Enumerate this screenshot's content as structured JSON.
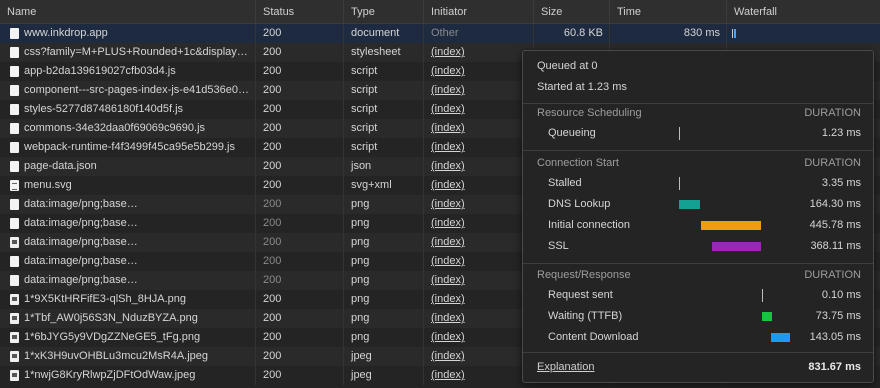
{
  "columns": [
    "Name",
    "Status",
    "Type",
    "Initiator",
    "Size",
    "Time",
    "Waterfall"
  ],
  "requests": [
    {
      "name": "www.inkdrop.app",
      "status": "200",
      "type": "document",
      "initiator": "Other",
      "size": "60.8 KB",
      "time": "830 ms",
      "icon": "document-icon"
    },
    {
      "name": "css?family=M+PLUS+Rounded+1c&display…",
      "status": "200",
      "type": "stylesheet",
      "initiator": "(index)",
      "icon": "document-icon"
    },
    {
      "name": "app-b2da139619027cfb03d4.js",
      "status": "200",
      "type": "script",
      "initiator": "(index)",
      "icon": "document-icon"
    },
    {
      "name": "component---src-pages-index-js-e41d536e0…",
      "status": "200",
      "type": "script",
      "initiator": "(index)",
      "icon": "document-icon"
    },
    {
      "name": "styles-5277d87486180f140d5f.js",
      "status": "200",
      "type": "script",
      "initiator": "(index)",
      "icon": "document-icon"
    },
    {
      "name": "commons-34e32daa0f69069c9690.js",
      "status": "200",
      "type": "script",
      "initiator": "(index)",
      "icon": "document-icon"
    },
    {
      "name": "webpack-runtime-f4f3499f45ca95e5b299.js",
      "status": "200",
      "type": "script",
      "initiator": "(index)",
      "icon": "document-icon"
    },
    {
      "name": "page-data.json",
      "status": "200",
      "type": "json",
      "initiator": "(index)",
      "icon": "document-icon"
    },
    {
      "name": "menu.svg",
      "status": "200",
      "type": "svg+xml",
      "initiator": "(index)",
      "icon": "menu-icon"
    },
    {
      "name": "data:image/png;base…",
      "status": "200",
      "type": "png",
      "initiator": "(index)",
      "icon": "document-icon",
      "status_dim": true
    },
    {
      "name": "data:image/png;base…",
      "status": "200",
      "type": "png",
      "initiator": "(index)",
      "icon": "document-icon",
      "status_dim": true
    },
    {
      "name": "data:image/png;base…",
      "status": "200",
      "type": "png",
      "initiator": "(index)",
      "icon": "image-icon",
      "status_dim": true
    },
    {
      "name": "data:image/png;base…",
      "status": "200",
      "type": "png",
      "initiator": "(index)",
      "icon": "document-icon",
      "status_dim": true
    },
    {
      "name": "data:image/png;base…",
      "status": "200",
      "type": "png",
      "initiator": "(index)",
      "icon": "document-icon",
      "status_dim": true
    },
    {
      "name": "1*9X5KtHRFifE3-qlSh_8HJA.png",
      "status": "200",
      "type": "png",
      "initiator": "(index)",
      "icon": "image-icon"
    },
    {
      "name": "1*Tbf_AW0j56S3N_NduzBYZA.png",
      "status": "200",
      "type": "png",
      "initiator": "(index)",
      "icon": "image-icon"
    },
    {
      "name": "1*6bJYG5y9VDgZZNeGE5_tFg.png",
      "status": "200",
      "type": "png",
      "initiator": "(index)",
      "icon": "image-icon"
    },
    {
      "name": "1*xK3H9uvOHBLu3mcu2MsR4A.jpeg",
      "status": "200",
      "type": "jpeg",
      "initiator": "(index)",
      "icon": "image-icon"
    },
    {
      "name": "1*nwjG8KryRlwpZjDFtOdWaw.jpeg",
      "status": "200",
      "type": "jpeg",
      "initiator": "(index)",
      "icon": "image-icon"
    }
  ],
  "tooltip": {
    "queued": "Queued at 0",
    "started": "Started at 1.23 ms",
    "duration_label": "DURATION",
    "sections": [
      {
        "title": "Resource Scheduling",
        "phases": [
          {
            "label": "Queueing",
            "value": "1.23 ms",
            "color": "#bdbdbd"
          }
        ]
      },
      {
        "title": "Connection Start",
        "phases": [
          {
            "label": "Stalled",
            "value": "3.35 ms",
            "color": "#bdbdbd"
          },
          {
            "label": "DNS Lookup",
            "value": "164.30 ms",
            "color": "#12a192"
          },
          {
            "label": "Initial connection",
            "value": "445.78 ms",
            "color": "#f29b0e"
          },
          {
            "label": "SSL",
            "value": "368.11 ms",
            "color": "#9c27b0"
          }
        ]
      },
      {
        "title": "Request/Response",
        "phases": [
          {
            "label": "Request sent",
            "value": "0.10 ms",
            "color": "#bdbdbd"
          },
          {
            "label": "Waiting (TTFB)",
            "value": "73.75 ms",
            "color": "#17c43a"
          },
          {
            "label": "Content Download",
            "value": "143.05 ms",
            "color": "#1a9bf0"
          }
        ]
      }
    ],
    "explanation": "Explanation",
    "total": "831.67 ms"
  }
}
